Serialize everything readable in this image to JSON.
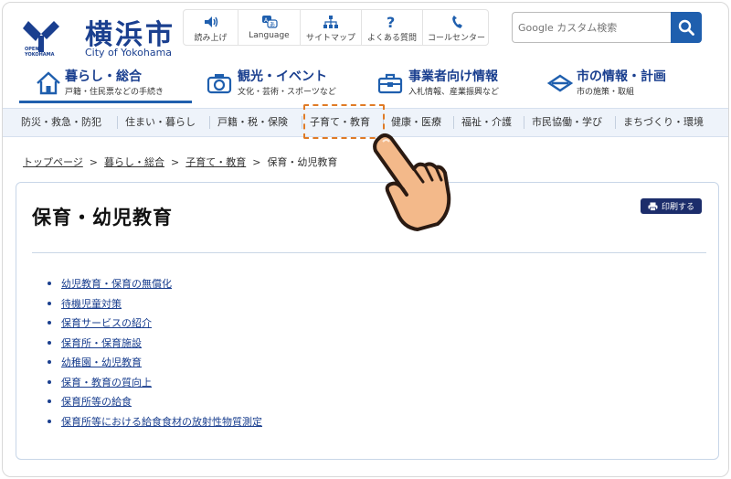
{
  "header": {
    "logo_small": "OPEN\nYOKOHAMA",
    "logo_title": "横浜市",
    "logo_sub": "City of Yokohama"
  },
  "utility_nav": [
    {
      "label": "読み上げ",
      "icon": "speaker-icon"
    },
    {
      "label": "Language",
      "icon": "language-icon"
    },
    {
      "label": "サイトマップ",
      "icon": "sitemap-icon"
    },
    {
      "label": "よくある質問",
      "icon": "question-icon"
    },
    {
      "label": "コールセンター",
      "icon": "phone-icon"
    }
  ],
  "search": {
    "placeholder": "Google カスタム検索",
    "button_icon": "search-icon"
  },
  "main_nav": [
    {
      "title": "暮らし・総合",
      "sub": "戸籍・住民票などの手続き",
      "icon": "house-icon",
      "active": true
    },
    {
      "title": "観光・イベント",
      "sub": "文化・芸術・スポーツなど",
      "icon": "camera-icon",
      "active": false
    },
    {
      "title": "事業者向け情報",
      "sub": "入札情報、産業振興など",
      "icon": "toolbox-icon",
      "active": false
    },
    {
      "title": "市の情報・計画",
      "sub": "市の施策・取組",
      "icon": "yokohama-mark-icon",
      "active": false
    }
  ],
  "sub_nav": [
    "防災・救急・防犯",
    "住まい・暮らし",
    "戸籍・税・保険",
    "子育て・教育",
    "健康・医療",
    "福祉・介護",
    "市民協働・学び",
    "まちづくり・環境"
  ],
  "breadcrumb": {
    "items": [
      "トップページ",
      "暮らし・総合",
      "子育て・教育"
    ],
    "current": "保育・幼児教育",
    "separator": ">"
  },
  "content": {
    "title": "保育・幼児教育",
    "print_label": "印刷する",
    "links": [
      "幼児教育・保育の無償化",
      "待機児童対策",
      "保育サービスの紹介",
      "保育所・保育施設",
      "幼稚園・幼児教育",
      "保育・教育の質向上",
      "保育所等の給食",
      "保育所等における給食食材の放射性物質測定"
    ]
  },
  "colors": {
    "brand_blue": "#1a3f8f",
    "search_button": "#1f5fae",
    "highlight": "#e07b26",
    "print_button": "#1c2d6b"
  }
}
